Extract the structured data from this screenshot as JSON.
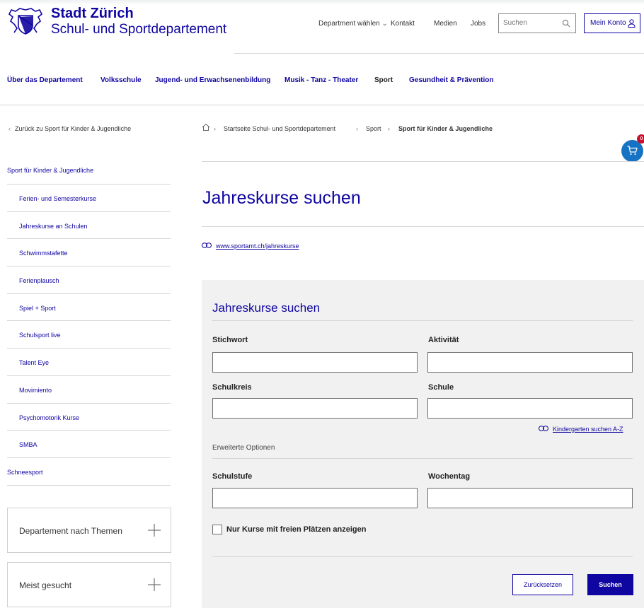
{
  "brand": {
    "title": "Stadt Zürich",
    "subtitle": "Schul- und Sportdepartement"
  },
  "top_nav": {
    "department_select": "Department wählen",
    "contact": "Kontakt",
    "media": "Medien",
    "jobs": "Jobs",
    "search_placeholder": "Suchen",
    "account": "Mein Konto"
  },
  "main_nav": [
    "Über das Departement",
    "Volksschule",
    "Jugend- und Erwachsenenbildung",
    "Musik - Tanz - Theater",
    "Sport",
    "Gesundheit & Prävention"
  ],
  "sidebar": {
    "back_link": "Zurück zu Sport für Kinder & Jugendliche",
    "section_title": "Sport für Kinder & Jugendliche",
    "items": [
      "Ferien- und Semesterkurse",
      "Jahreskurse an Schulen",
      "Schwimmstafette",
      "Ferienplausch",
      "Spiel + Sport",
      "Schulsport live",
      "Talent Eye",
      "Movimiento",
      "Psychomotorik Kurse",
      "SMBA",
      "Schneesport"
    ],
    "accordions": [
      "Departement nach Themen",
      "Meist gesucht"
    ]
  },
  "breadcrumb": [
    "Startseite Schul- und Sportdepartement",
    "Sport",
    "Sport für Kinder & Jugendliche"
  ],
  "cart": {
    "count": "0"
  },
  "page_title": "Jahreskurse suchen",
  "external_link": "www.sportamt.ch/jahreskurse",
  "form": {
    "title": "Jahreskurse suchen",
    "fields": {
      "keyword": "Stichwort",
      "activity": "Aktivität",
      "school_district": "Schulkreis",
      "school": "Schule",
      "school_level": "Schulstufe",
      "weekday": "Wochentag"
    },
    "kindergarten_link": "Kindergarten suchen A-Z",
    "advanced_options": "Erweiterte Optionen",
    "free_places_checkbox": "Nur Kurse mit freien Plätzen anzeigen",
    "free_places_checked": false,
    "reset_button": "Zurücksetzen",
    "search_button": "Suchen"
  },
  "colors": {
    "brand_blue": "#0f05a0",
    "cart_blue": "#1673c4",
    "badge_red": "#c8102e",
    "panel_bg": "#f1f1f1"
  }
}
